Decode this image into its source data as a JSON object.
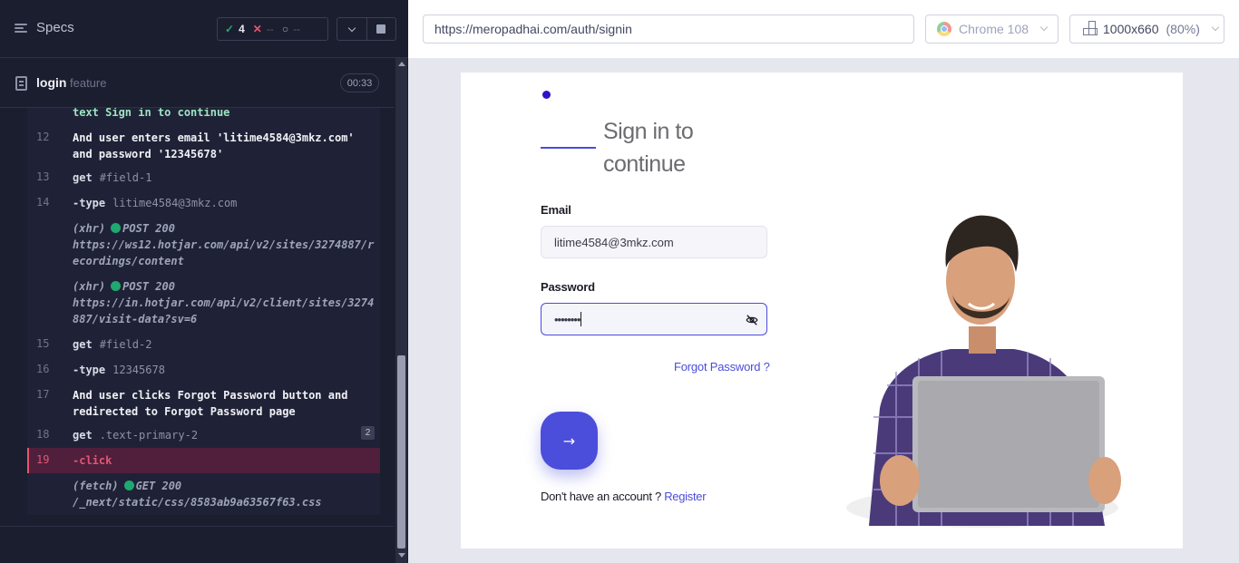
{
  "runner": {
    "specs_label": "Specs",
    "stats": {
      "passed": "4",
      "failed": "--",
      "pending": "--"
    },
    "file": {
      "name": "login",
      "ext": "feature",
      "time": "00:33"
    },
    "log": [
      {
        "num": "",
        "text": "text  Sign in to continue"
      },
      {
        "num": "12",
        "text": "And   user enters email 'litime4584@3mkz.com' and password '12345678'"
      },
      {
        "num": "13",
        "cmd": "get",
        "arg": "#field-1"
      },
      {
        "num": "14",
        "cmd": "-type",
        "arg": "litime4584@3mkz.com"
      },
      {
        "num": "",
        "net_type": "(xhr)",
        "method": "POST 200",
        "url": "https://ws12.hotjar.com/api/v2/sites/3274887/recordings/content"
      },
      {
        "num": "",
        "net_type": "(xhr)",
        "method": "POST 200",
        "url": "https://in.hotjar.com/api/v2/client/sites/3274887/visit-data?sv=6"
      },
      {
        "num": "15",
        "cmd": "get",
        "arg": "#field-2"
      },
      {
        "num": "16",
        "cmd": "-type",
        "arg": "12345678"
      },
      {
        "num": "17",
        "text": "And   user clicks Forgot Password button and redirected to Forgot Password page"
      },
      {
        "num": "18",
        "cmd": "get",
        "arg": ".text-primary-2",
        "badge": "2"
      },
      {
        "num": "19",
        "cmd": "-click"
      },
      {
        "num": "",
        "net_type": "(fetch)",
        "method": "GET 200",
        "url": "/_next/static/css/8583ab9a63567f63.css"
      }
    ]
  },
  "browser": {
    "url": "https://meropadhai.com/auth/signin",
    "browser_name": "Chrome 108",
    "viewport": "1000x660",
    "zoom": "(80%)"
  },
  "app": {
    "title": "Sign in to continue",
    "email_label": "Email",
    "email_value": "litime4584@3mkz.com",
    "password_label": "Password",
    "password_value": "••••••••",
    "forgot_label": "Forgot Password ?",
    "submit_arrow": "→",
    "no_account_text": "Don't have an account ?",
    "register_label": "Register"
  },
  "colors": {
    "accent": "#4b4ddb",
    "pass": "#1fa971",
    "fail": "#e45770",
    "runner_bg": "#1b1e2e"
  }
}
